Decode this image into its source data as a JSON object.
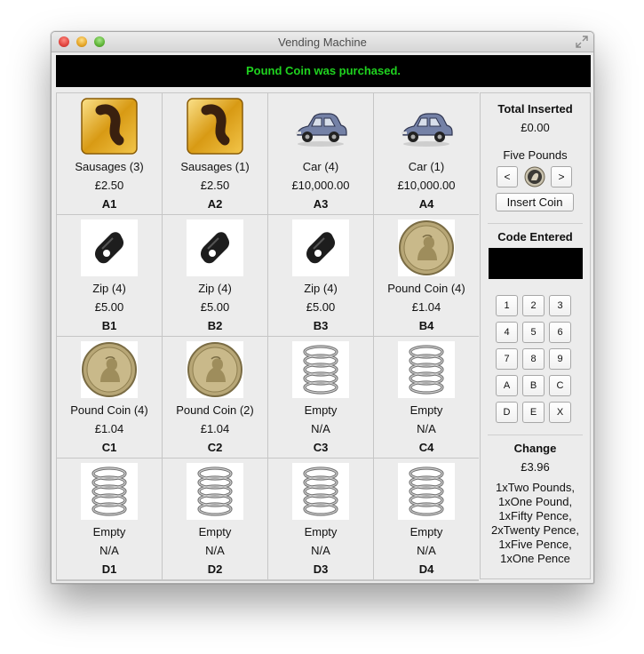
{
  "window": {
    "title": "Vending Machine"
  },
  "status_message": "Pound Coin was purchased.",
  "colors": {
    "status_text": "#1fd31f",
    "status_bg": "#000000"
  },
  "slots": [
    {
      "name": "Sausages (3)",
      "price": "£2.50",
      "code": "A1",
      "icon": "sausage-icon"
    },
    {
      "name": "Sausages (1)",
      "price": "£2.50",
      "code": "A2",
      "icon": "sausage-icon"
    },
    {
      "name": "Car (4)",
      "price": "£10,000.00",
      "code": "A3",
      "icon": "car-icon"
    },
    {
      "name": "Car (1)",
      "price": "£10,000.00",
      "code": "A4",
      "icon": "car-icon"
    },
    {
      "name": "Zip (4)",
      "price": "£5.00",
      "code": "B1",
      "icon": "zip-icon"
    },
    {
      "name": "Zip (4)",
      "price": "£5.00",
      "code": "B2",
      "icon": "zip-icon"
    },
    {
      "name": "Zip (4)",
      "price": "£5.00",
      "code": "B3",
      "icon": "zip-icon"
    },
    {
      "name": "Pound Coin (4)",
      "price": "£1.04",
      "code": "B4",
      "icon": "pound-coin-icon"
    },
    {
      "name": "Pound Coin (4)",
      "price": "£1.04",
      "code": "C1",
      "icon": "pound-coin-icon"
    },
    {
      "name": "Pound Coin (2)",
      "price": "£1.04",
      "code": "C2",
      "icon": "pound-coin-icon"
    },
    {
      "name": "Empty",
      "price": "N/A",
      "code": "C3",
      "icon": "spring-icon"
    },
    {
      "name": "Empty",
      "price": "N/A",
      "code": "C4",
      "icon": "spring-icon"
    },
    {
      "name": "Empty",
      "price": "N/A",
      "code": "D1",
      "icon": "spring-icon"
    },
    {
      "name": "Empty",
      "price": "N/A",
      "code": "D2",
      "icon": "spring-icon"
    },
    {
      "name": "Empty",
      "price": "N/A",
      "code": "D3",
      "icon": "spring-icon"
    },
    {
      "name": "Empty",
      "price": "N/A",
      "code": "D4",
      "icon": "spring-icon"
    }
  ],
  "sidebar": {
    "total_heading": "Total Inserted",
    "total_value": "£0.00",
    "coin_label": "Five Pounds",
    "prev_label": "<",
    "next_label": ">",
    "insert_label": "Insert Coin",
    "code_heading": "Code Entered",
    "code_value": "",
    "keypad": [
      "1",
      "2",
      "3",
      "4",
      "5",
      "6",
      "7",
      "8",
      "9",
      "A",
      "B",
      "C",
      "D",
      "E",
      "X"
    ],
    "change_heading": "Change",
    "change_value": "£3.96",
    "change_lines": [
      "1xTwo Pounds,",
      "1xOne Pound,",
      "1xFifty Pence,",
      "2xTwenty Pence,",
      "1xFive Pence,",
      "1xOne Pence"
    ]
  }
}
